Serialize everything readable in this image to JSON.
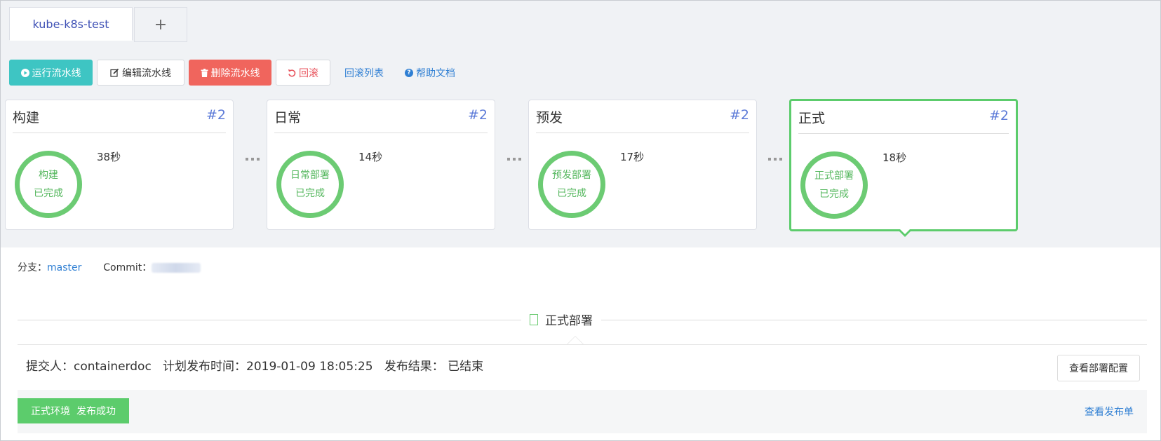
{
  "tabs": {
    "active_label": "kube-k8s-test",
    "add_label": "+"
  },
  "toolbar": {
    "run_label": "运行流水线",
    "edit_label": "编辑流水线",
    "delete_label": "删除流水线",
    "rollback_label": "回滚",
    "rollback_list_label": "回滚列表",
    "help_label": "帮助文档"
  },
  "stages": [
    {
      "title": "构建",
      "number": "#2",
      "ring_line1": "构建",
      "ring_line2": "已完成",
      "duration": "38秒"
    },
    {
      "title": "日常",
      "number": "#2",
      "ring_line1": "日常部署",
      "ring_line2": "已完成",
      "duration": "14秒"
    },
    {
      "title": "预发",
      "number": "#2",
      "ring_line1": "预发部署",
      "ring_line2": "已完成",
      "duration": "17秒"
    },
    {
      "title": "正式",
      "number": "#2",
      "ring_line1": "正式部署",
      "ring_line2": "已完成",
      "duration": "18秒"
    }
  ],
  "detail": {
    "branch_label": "分支：",
    "branch_value": "master",
    "commit_label": "Commit：",
    "section_title": "正式部署",
    "info_text": "提交人：containerdoc   计划发布时间：2019-01-09 18:05:25   发布结果： 已结束",
    "view_config_label": "查看部署配置",
    "success_badge": "正式环境  发布成功",
    "view_release_label": "查看发布单"
  },
  "colors": {
    "accent_green": "#5ccc6c",
    "run_teal": "#3ec5c3",
    "delete_red": "#f0655d",
    "link_blue": "#2f7fd3"
  }
}
